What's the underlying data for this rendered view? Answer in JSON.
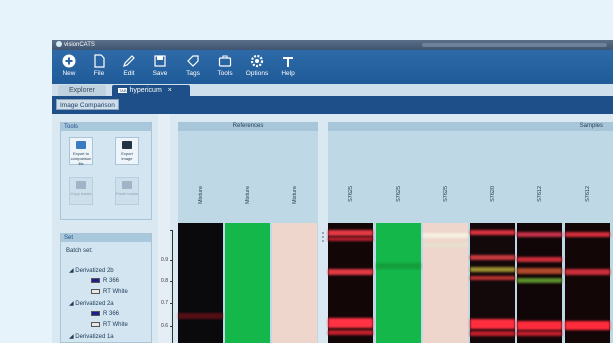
{
  "window": {
    "app_title": "visionCATS"
  },
  "ribbon": [
    {
      "label": "New",
      "icon": "plus-icon"
    },
    {
      "label": "File",
      "icon": "file-icon"
    },
    {
      "label": "Edit",
      "icon": "pencil-icon"
    },
    {
      "label": "Save",
      "icon": "save-icon"
    },
    {
      "label": "Tags",
      "icon": "tag-icon"
    },
    {
      "label": "Tools",
      "icon": "toolbox-icon"
    },
    {
      "label": "Options",
      "icon": "gear-icon"
    },
    {
      "label": "Help",
      "icon": "help-icon"
    }
  ],
  "tabs": {
    "explorer": "Explorer",
    "active_badge": "TAB",
    "active": "hypericum",
    "close": "×"
  },
  "subtoolbar": {
    "image_comparison": "Image Comparison"
  },
  "tools_panel": {
    "title": "Tools",
    "buttons": [
      {
        "label": "Export to comparison file",
        "enabled": true
      },
      {
        "label": "Export image",
        "enabled": true
      },
      {
        "label": "Copy tracks",
        "enabled": false
      },
      {
        "label": "Paste tracks",
        "enabled": false
      }
    ]
  },
  "set_panel": {
    "title": "Set",
    "batch_set": "Batch set:",
    "groups": [
      {
        "name": "Derivatized 2b",
        "items": [
          {
            "label": "R 366",
            "color": "#1e1e8c"
          },
          {
            "label": "RT White",
            "color": "#e6e6e6"
          }
        ]
      },
      {
        "name": "Derivatized 2a",
        "items": [
          {
            "label": "R 366",
            "color": "#1e1e8c"
          },
          {
            "label": "RT White",
            "color": "#e6e6e6"
          }
        ]
      },
      {
        "name": "Derivatized 1a"
      }
    ]
  },
  "axis_ticks": [
    "0.9",
    "0.8",
    "0.7",
    "0.6"
  ],
  "references": {
    "title": "References",
    "lanes": [
      {
        "label": "Mixture",
        "bg": "#0a0a0d"
      },
      {
        "label": "Mixture",
        "bg": "#14b84a"
      },
      {
        "label": "Mixture",
        "bg": "#efd6cc"
      }
    ]
  },
  "samples": {
    "title": "Samples",
    "lanes": [
      {
        "label": "S7625",
        "bg": "#120607"
      },
      {
        "label": "S7625",
        "bg": "#14b84a"
      },
      {
        "label": "S7625",
        "bg": "#efd6cc"
      },
      {
        "label": "S7620",
        "bg": "#14090a"
      },
      {
        "label": "S7612",
        "bg": "#110607"
      },
      {
        "label": "S7612",
        "bg": "#120607"
      }
    ]
  }
}
